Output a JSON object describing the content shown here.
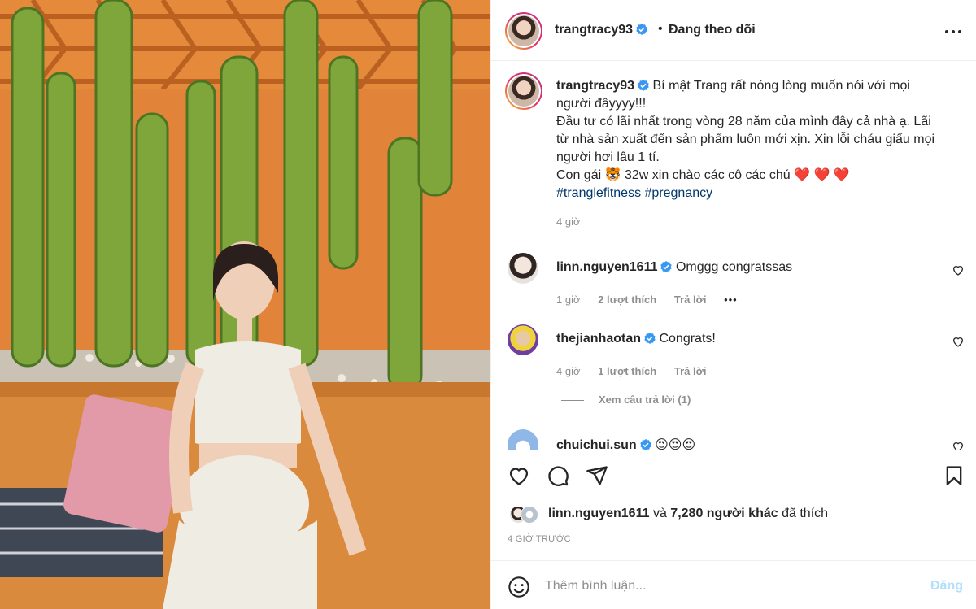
{
  "header": {
    "username": "trangtracy93",
    "separator": "•",
    "follow_status": "Đang theo dõi"
  },
  "caption": {
    "username": "trangtracy93",
    "lines": [
      "Bí mật Trang rất nóng lòng muốn nói với mọi",
      "người đâyyyy!!!",
      "Đầu tư có lãi nhất trong vòng 28 năm của mình đây cả nhà ạ. Lãi",
      "từ nhà sản xuất đến sản phẩm luôn mới xịn. Xin lỗi cháu giấu mọi",
      "người hơi lâu 1 tí.",
      "Con gái 🐯 32w xin chào các cô các chú ❤️ ❤️ ❤️"
    ],
    "hashtags": "#tranglefitness #pregnancy",
    "time": "4 giờ"
  },
  "comments": [
    {
      "username": "linn.nguyen1611",
      "text": "Omggg congratssas",
      "time": "1 giờ",
      "likes": "2 lượt thích",
      "reply": "Trả lời",
      "more": "•••"
    },
    {
      "username": "thejianhaotan",
      "text": "Congrats!",
      "time": "4 giờ",
      "likes": "1 lượt thích",
      "reply": "Trả lời"
    },
    {
      "username": "chuichui.sun",
      "text": "😍😍😍"
    }
  ],
  "view_replies": "Xem câu trả lời (1)",
  "likes": {
    "first_user": "linn.nguyen1611",
    "connector": "và",
    "others": "7,280 người khác",
    "suffix": "đã thích"
  },
  "post_date": "4 GIỜ TRƯỚC",
  "add_comment": {
    "placeholder": "Thêm bình luận...",
    "post_label": "Đăng"
  },
  "colors": {
    "verified": "#3897f0",
    "hashtag": "#00376b",
    "secondary_text": "#8e8e8e",
    "post_button_disabled": "#b2dffc"
  }
}
